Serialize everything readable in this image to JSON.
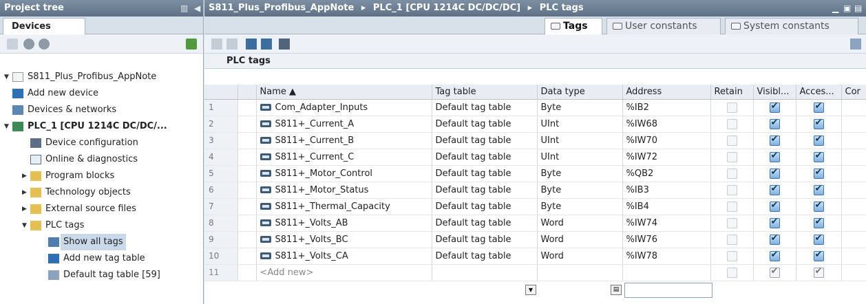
{
  "left": {
    "title": "Project tree",
    "devices_tab": "Devices",
    "tree": [
      {
        "label": "S811_Plus_Profibus_AppNote",
        "icon": "project-icon",
        "toggle": "▼"
      },
      {
        "label": "Add new device",
        "icon": "add-device-icon",
        "toggle": ""
      },
      {
        "label": "Devices & networks",
        "icon": "network-icon",
        "toggle": ""
      },
      {
        "label": "PLC_1 [CPU 1214C DC/DC/...",
        "icon": "plc-icon",
        "toggle": "▼"
      },
      {
        "label": "Device configuration",
        "icon": "device-config-icon",
        "toggle": ""
      },
      {
        "label": "Online & diagnostics",
        "icon": "diagnostics-icon",
        "toggle": ""
      },
      {
        "label": "Program blocks",
        "icon": "folder-icon",
        "toggle": "▶"
      },
      {
        "label": "Technology objects",
        "icon": "folder-icon",
        "toggle": "▶"
      },
      {
        "label": "External source files",
        "icon": "folder-icon",
        "toggle": "▶"
      },
      {
        "label": "PLC tags",
        "icon": "folder-icon",
        "toggle": "▼"
      },
      {
        "label": "Show all tags",
        "icon": "show-tags-icon",
        "toggle": ""
      },
      {
        "label": "Add new tag table",
        "icon": "add-tag-table-icon",
        "toggle": ""
      },
      {
        "label": "Default tag table [59]",
        "icon": "tag-table-icon",
        "toggle": ""
      }
    ]
  },
  "editor": {
    "breadcrumb": [
      "S811_Plus_Profibus_AppNote",
      "PLC_1 [CPU 1214C DC/DC/DC]",
      "PLC tags"
    ],
    "breadcrumb_sep": "▸",
    "tabs": [
      "Tags",
      "User constants",
      "System constants"
    ],
    "section_title": "PLC tags"
  },
  "table": {
    "columns": [
      "",
      "",
      "Name ▲",
      "Tag table",
      "Data type",
      "Address",
      "Retain",
      "Visibl...",
      "Acces...",
      "Cor"
    ],
    "rows": [
      {
        "n": "1",
        "name": "Com_Adapter_Inputs",
        "table": "Default tag table",
        "type": "Byte",
        "address": "%IB2"
      },
      {
        "n": "2",
        "name": "S811+_Current_A",
        "table": "Default tag table",
        "type": "UInt",
        "address": "%IW68"
      },
      {
        "n": "3",
        "name": "S811+_Current_B",
        "table": "Default tag table",
        "type": "UInt",
        "address": "%IW70"
      },
      {
        "n": "4",
        "name": "S811+_Current_C",
        "table": "Default tag table",
        "type": "UInt",
        "address": "%IW72"
      },
      {
        "n": "5",
        "name": "S811+_Motor_Control",
        "table": "Default tag table",
        "type": "Byte",
        "address": "%QB2"
      },
      {
        "n": "6",
        "name": "S811+_Motor_Status",
        "table": "Default tag table",
        "type": "Byte",
        "address": "%IB3"
      },
      {
        "n": "7",
        "name": "S811+_Thermal_Capacity",
        "table": "Default tag table",
        "type": "Byte",
        "address": "%IB4"
      },
      {
        "n": "8",
        "name": "S811+_Volts_AB",
        "table": "Default tag table",
        "type": "Word",
        "address": "%IW74"
      },
      {
        "n": "9",
        "name": "S811+_Volts_BC",
        "table": "Default tag table",
        "type": "Word",
        "address": "%IW76"
      },
      {
        "n": "10",
        "name": "S811+_Volts_CA",
        "table": "Default tag table",
        "type": "Word",
        "address": "%IW78"
      }
    ],
    "add_row": {
      "n": "11",
      "placeholder": "<Add new>"
    }
  },
  "colors": {
    "title_bar": "#5e7186",
    "accent": "#3d74aa",
    "selection": "#c9d9ea"
  }
}
